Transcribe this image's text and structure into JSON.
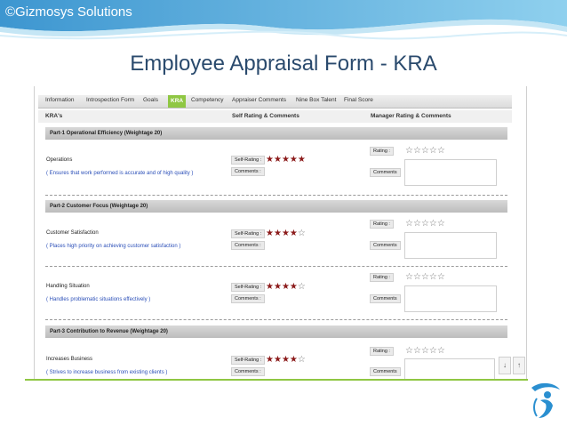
{
  "header": {
    "copyright": "©Gizmosys Solutions",
    "title": "Employee Appraisal Form - KRA"
  },
  "tabs": [
    {
      "label": "Information"
    },
    {
      "label": "Introspection Form"
    },
    {
      "label": "Goals"
    },
    {
      "label": "KRA"
    },
    {
      "label": "Competency"
    },
    {
      "label": "Appraiser Comments"
    },
    {
      "label": "Nine Box Talent"
    },
    {
      "label": "Final Score"
    }
  ],
  "active_tab": "KRA",
  "columns": {
    "kra": "KRA's",
    "self": "Self Rating & Comments",
    "manager": "Manager Rating & Comments"
  },
  "labels": {
    "self_rating": "Self-Rating :",
    "comments": "Comments :",
    "rating": "Rating :",
    "mgr_comments": "Comments"
  },
  "parts": [
    {
      "title": "Part-1 Operational Efficiency (Weightage 20)"
    },
    {
      "title": "Part-2 Customer Focus (Weightage 20)"
    },
    {
      "title": "Part-3 Contribution to Revenue (Weightage 20)"
    }
  ],
  "kras": [
    {
      "name": "Operations",
      "desc": "( Ensures that work performed is accurate and of high quality  )",
      "self_rating": 5,
      "manager_rating": 0
    },
    {
      "name": "Customer Satisfaction",
      "desc": "( Places high priority on achieving customer satisfaction )",
      "self_rating": 4,
      "manager_rating": 0
    },
    {
      "name": "Handling Situation",
      "desc": "( Handles problematic situations effectively )",
      "self_rating": 4,
      "manager_rating": 0
    },
    {
      "name": "Increases Business",
      "desc": "( Strives to increase business from existing clients )",
      "self_rating": 4,
      "manager_rating": 0
    }
  ],
  "max_stars": 5,
  "colors": {
    "header_blue": "#4aa3d9",
    "title_text": "#2a4a6d",
    "active_tab": "#8fc743",
    "star_on": "#8b1a1a",
    "desc_text": "#2b4fb8"
  },
  "icons": {
    "scroll_down": "arrow-down-icon",
    "scroll_up": "arrow-up-icon",
    "logo": "gizmosys-logo"
  }
}
